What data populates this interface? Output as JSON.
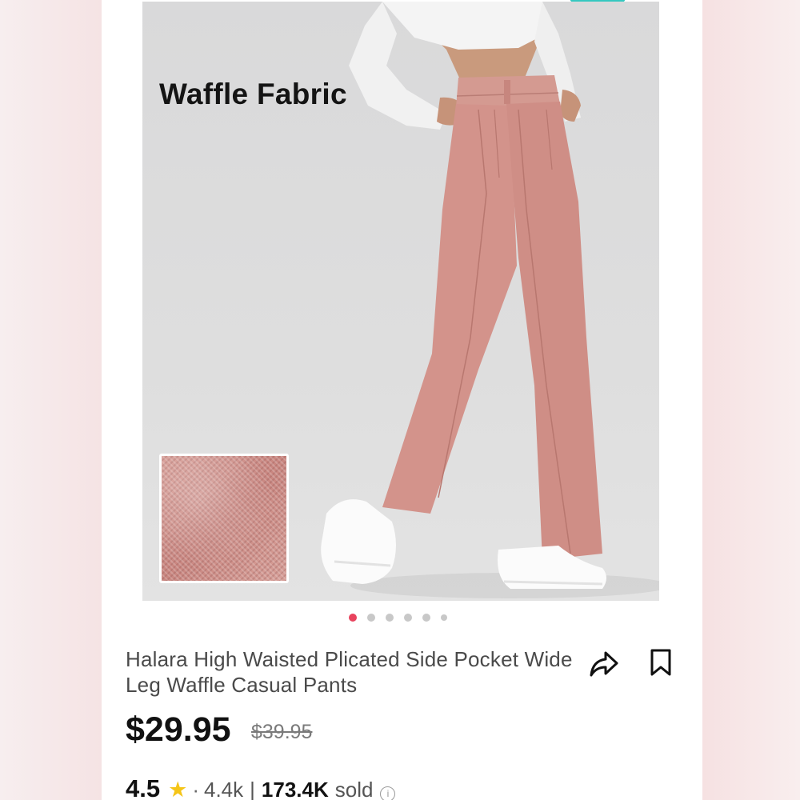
{
  "product": {
    "image_tag": "Waffle Fabric",
    "title": "Halara High Waisted Plicated Side Pocket Wide Leg Waffle Casual Pants",
    "price": "$29.95",
    "original_price": "$39.95"
  },
  "gallery": {
    "total_images": 6,
    "active_index": 0
  },
  "rating": {
    "score": "4.5",
    "separator": "·",
    "reviews": "4.4k",
    "divider": "|",
    "sold_count": "173.4K",
    "sold_label": "sold",
    "info_glyph": "i"
  },
  "icons": {
    "share": "share-arrow-icon",
    "bookmark": "bookmark-icon",
    "star": "star-icon",
    "info": "info-icon"
  },
  "colors": {
    "accent": "#e8435d",
    "pants": "#d3938b",
    "star": "#f5c518"
  }
}
